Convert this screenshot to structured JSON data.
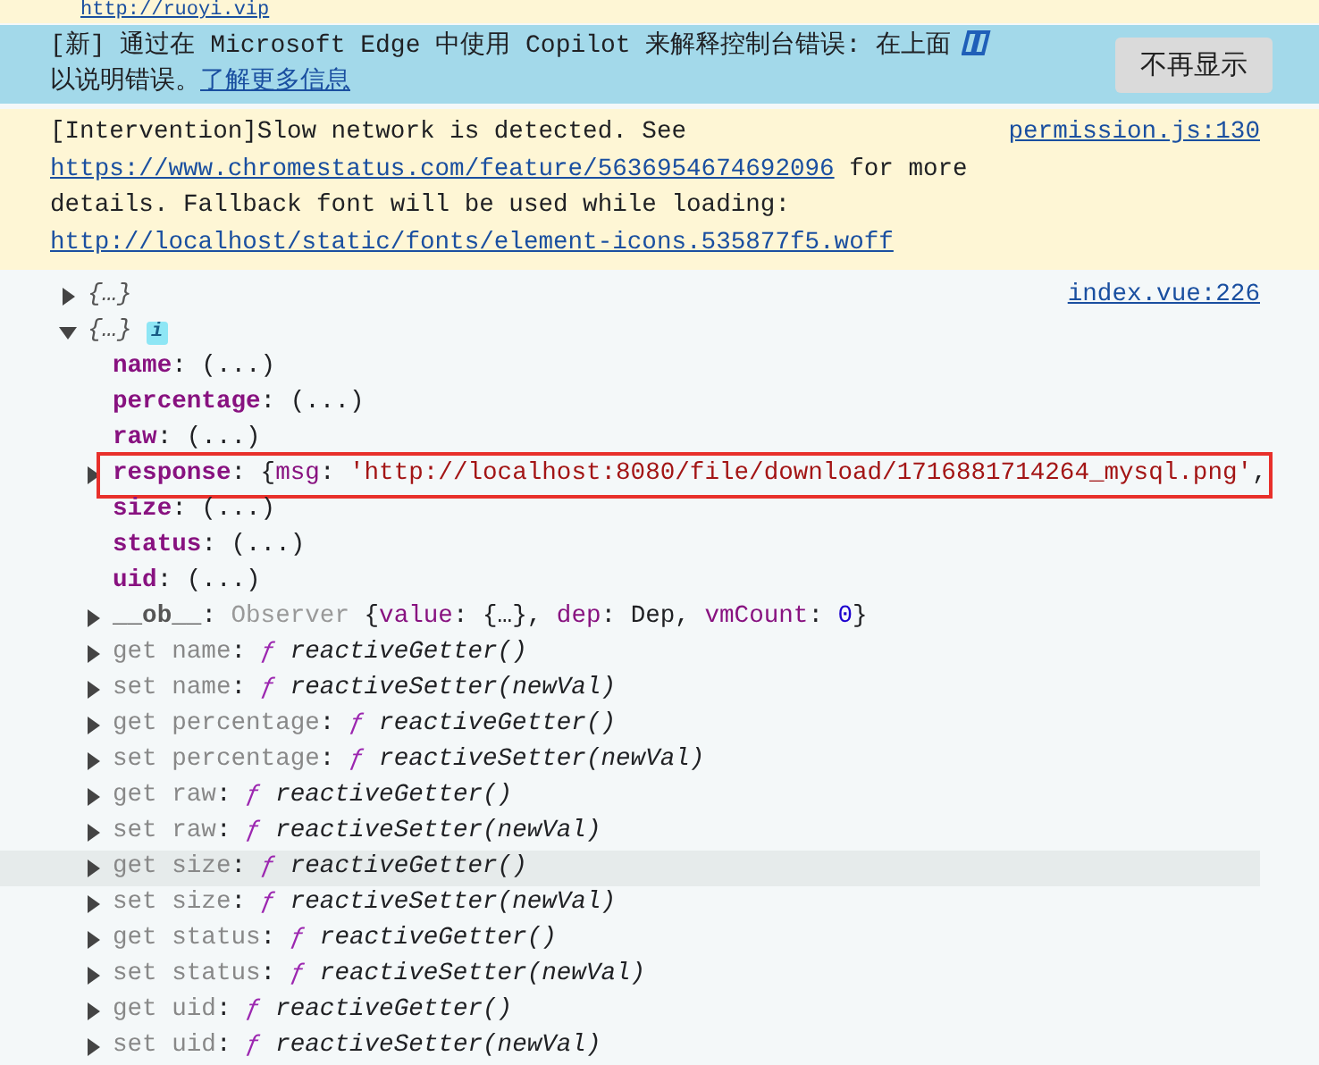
{
  "top_link": "http://ruoyi.vip",
  "copilot_banner": {
    "text": "[新] 通过在 Microsoft Edge 中使用 Copilot 来解释控制台错误: 在上面",
    "text2": "以说明错误。",
    "link": "了解更多信息",
    "button": "不再显示"
  },
  "intervention": {
    "lines": [
      {
        "segments": [
          {
            "kind": "text",
            "t": "[Intervention]Slow network is detected. See"
          }
        ]
      },
      {
        "segments": [
          {
            "kind": "link",
            "t": "https://www.chromestatus.com/feature/5636954674692096"
          },
          {
            "kind": "text",
            "t": " for more"
          }
        ]
      },
      {
        "segments": [
          {
            "kind": "text",
            "t": "details. Fallback font will be used while loading:"
          }
        ]
      },
      {
        "segments": [
          {
            "kind": "link",
            "t": "http://localhost/static/fonts/element-icons.535877f5.woff"
          }
        ]
      }
    ],
    "source": "permission.js:130"
  },
  "console": {
    "source": "index.vue:226",
    "entries": [
      {
        "summary": "{…}",
        "expanded": false
      },
      {
        "summary": "{…}",
        "expanded": true,
        "badge": "i",
        "children": [
          {
            "hovered": false,
            "outlined": false,
            "segments": [
              {
                "kind": "key",
                "t": "name"
              },
              {
                "kind": "punct",
                "t": ": (...)"
              }
            ]
          },
          {
            "hovered": false,
            "outlined": false,
            "segments": [
              {
                "kind": "key",
                "t": "percentage"
              },
              {
                "kind": "punct",
                "t": ": (...)"
              }
            ]
          },
          {
            "hovered": false,
            "outlined": false,
            "segments": [
              {
                "kind": "key",
                "t": "raw"
              },
              {
                "kind": "punct",
                "t": ": (...)"
              }
            ]
          },
          {
            "expanded": false,
            "hovered": false,
            "outlined": true,
            "segments": [
              {
                "kind": "key",
                "t": "response"
              },
              {
                "kind": "punct",
                "t": ": {"
              },
              {
                "kind": "prop",
                "t": "msg"
              },
              {
                "kind": "punct",
                "t": ": "
              },
              {
                "kind": "string",
                "t": "'http://localhost:8080/file/download/1716881714264_mysql.png'"
              },
              {
                "kind": "punct",
                "t": ","
              }
            ]
          },
          {
            "hovered": false,
            "outlined": false,
            "segments": [
              {
                "kind": "key",
                "t": "size"
              },
              {
                "kind": "punct",
                "t": ": (...)"
              }
            ]
          },
          {
            "hovered": false,
            "outlined": false,
            "segments": [
              {
                "kind": "key",
                "t": "status"
              },
              {
                "kind": "punct",
                "t": ": (...)"
              }
            ]
          },
          {
            "hovered": false,
            "outlined": false,
            "segments": [
              {
                "kind": "key",
                "t": "uid"
              },
              {
                "kind": "punct",
                "t": ": (...)"
              }
            ]
          },
          {
            "expanded": false,
            "hovered": false,
            "outlined": false,
            "segments": [
              {
                "kind": "internal",
                "t": "__ob__"
              },
              {
                "kind": "punct",
                "t": ": "
              },
              {
                "kind": "class",
                "t": "Observer "
              },
              {
                "kind": "punct",
                "t": "{"
              },
              {
                "kind": "prop",
                "t": "value"
              },
              {
                "kind": "punct",
                "t": ": {…}, "
              },
              {
                "kind": "prop",
                "t": "dep"
              },
              {
                "kind": "punct",
                "t": ": Dep, "
              },
              {
                "kind": "prop",
                "t": "vmCount"
              },
              {
                "kind": "punct",
                "t": ": "
              },
              {
                "kind": "number",
                "t": "0"
              },
              {
                "kind": "punct",
                "t": "}"
              }
            ]
          },
          {
            "expanded": false,
            "hovered": false,
            "outlined": false,
            "segments": [
              {
                "kind": "accessor",
                "t": "get name"
              },
              {
                "kind": "punct",
                "t": ": "
              },
              {
                "kind": "fn",
                "t": "ƒ"
              },
              {
                "kind": "fnname",
                "t": " reactiveGetter()"
              }
            ]
          },
          {
            "expanded": false,
            "hovered": false,
            "outlined": false,
            "segments": [
              {
                "kind": "accessor",
                "t": "set name"
              },
              {
                "kind": "punct",
                "t": ": "
              },
              {
                "kind": "fn",
                "t": "ƒ"
              },
              {
                "kind": "fnname",
                "t": " reactiveSetter(newVal)"
              }
            ]
          },
          {
            "expanded": false,
            "hovered": false,
            "outlined": false,
            "segments": [
              {
                "kind": "accessor",
                "t": "get percentage"
              },
              {
                "kind": "punct",
                "t": ": "
              },
              {
                "kind": "fn",
                "t": "ƒ"
              },
              {
                "kind": "fnname",
                "t": " reactiveGetter()"
              }
            ]
          },
          {
            "expanded": false,
            "hovered": false,
            "outlined": false,
            "segments": [
              {
                "kind": "accessor",
                "t": "set percentage"
              },
              {
                "kind": "punct",
                "t": ": "
              },
              {
                "kind": "fn",
                "t": "ƒ"
              },
              {
                "kind": "fnname",
                "t": " reactiveSetter(newVal)"
              }
            ]
          },
          {
            "expanded": false,
            "hovered": false,
            "outlined": false,
            "segments": [
              {
                "kind": "accessor",
                "t": "get raw"
              },
              {
                "kind": "punct",
                "t": ": "
              },
              {
                "kind": "fn",
                "t": "ƒ"
              },
              {
                "kind": "fnname",
                "t": " reactiveGetter()"
              }
            ]
          },
          {
            "expanded": false,
            "hovered": false,
            "outlined": false,
            "segments": [
              {
                "kind": "accessor",
                "t": "set raw"
              },
              {
                "kind": "punct",
                "t": ": "
              },
              {
                "kind": "fn",
                "t": "ƒ"
              },
              {
                "kind": "fnname",
                "t": " reactiveSetter(newVal)"
              }
            ]
          },
          {
            "expanded": false,
            "hovered": true,
            "outlined": false,
            "segments": [
              {
                "kind": "accessor",
                "t": "get size"
              },
              {
                "kind": "punct",
                "t": ": "
              },
              {
                "kind": "fn",
                "t": "ƒ"
              },
              {
                "kind": "fnname",
                "t": " reactiveGetter()"
              }
            ]
          },
          {
            "expanded": false,
            "hovered": false,
            "outlined": false,
            "segments": [
              {
                "kind": "accessor",
                "t": "set size"
              },
              {
                "kind": "punct",
                "t": ": "
              },
              {
                "kind": "fn",
                "t": "ƒ"
              },
              {
                "kind": "fnname",
                "t": " reactiveSetter(newVal)"
              }
            ]
          },
          {
            "expanded": false,
            "hovered": false,
            "outlined": false,
            "segments": [
              {
                "kind": "accessor",
                "t": "get status"
              },
              {
                "kind": "punct",
                "t": ": "
              },
              {
                "kind": "fn",
                "t": "ƒ"
              },
              {
                "kind": "fnname",
                "t": " reactiveGetter()"
              }
            ]
          },
          {
            "expanded": false,
            "hovered": false,
            "outlined": false,
            "segments": [
              {
                "kind": "accessor",
                "t": "set status"
              },
              {
                "kind": "punct",
                "t": ": "
              },
              {
                "kind": "fn",
                "t": "ƒ"
              },
              {
                "kind": "fnname",
                "t": " reactiveSetter(newVal)"
              }
            ]
          },
          {
            "expanded": false,
            "hovered": false,
            "outlined": false,
            "segments": [
              {
                "kind": "accessor",
                "t": "get uid"
              },
              {
                "kind": "punct",
                "t": ": "
              },
              {
                "kind": "fn",
                "t": "ƒ"
              },
              {
                "kind": "fnname",
                "t": " reactiveGetter()"
              }
            ]
          },
          {
            "expanded": false,
            "hovered": false,
            "outlined": false,
            "segments": [
              {
                "kind": "accessor",
                "t": "set uid"
              },
              {
                "kind": "punct",
                "t": ": "
              },
              {
                "kind": "fn",
                "t": "ƒ"
              },
              {
                "kind": "fnname",
                "t": " reactiveSetter(newVal)"
              }
            ]
          }
        ]
      }
    ]
  }
}
